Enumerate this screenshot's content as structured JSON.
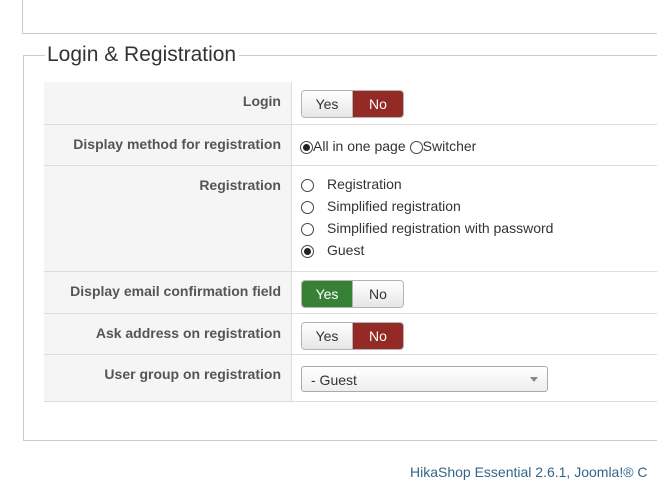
{
  "fieldset": {
    "legend": "Login & Registration"
  },
  "rows": {
    "login": {
      "label": "Login",
      "yes": "Yes",
      "no": "No",
      "selected": "No"
    },
    "display_method": {
      "label": "Display method for registration",
      "options": [
        "All in one page",
        "Switcher"
      ],
      "selected": "All in one page"
    },
    "registration": {
      "label": "Registration",
      "options": [
        "Registration",
        "Simplified registration",
        "Simplified registration with password",
        "Guest"
      ],
      "selected": "Guest"
    },
    "email_confirmation": {
      "label": "Display email confirmation field",
      "yes": "Yes",
      "no": "No",
      "selected": "Yes"
    },
    "ask_address": {
      "label": "Ask address on registration",
      "yes": "Yes",
      "no": "No",
      "selected": "No"
    },
    "user_group": {
      "label": "User group on registration",
      "value": "- Guest"
    }
  },
  "footer": {
    "text": "HikaShop Essential 2.6.1, Joomla!® C"
  },
  "colors": {
    "no_active": "#942a25",
    "yes_active": "#378137",
    "footer_link": "#33658a"
  }
}
